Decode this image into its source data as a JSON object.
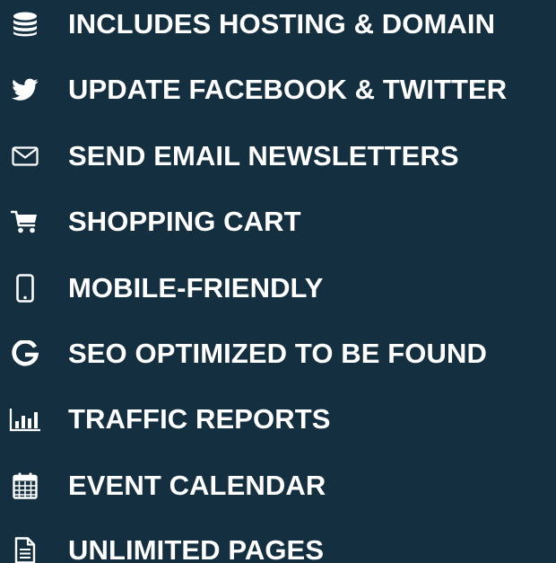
{
  "theme": {
    "background": "#142f40",
    "text": "#ffffff"
  },
  "features": [
    {
      "icon": "database-icon",
      "label": "INCLUDES HOSTING & DOMAIN"
    },
    {
      "icon": "twitter-bird-icon",
      "label": "UPDATE FACEBOOK & TWITTER"
    },
    {
      "icon": "envelope-icon",
      "label": "SEND EMAIL NEWSLETTERS"
    },
    {
      "icon": "shopping-cart-icon",
      "label": "SHOPPING CART"
    },
    {
      "icon": "mobile-phone-icon",
      "label": "MOBILE-FRIENDLY"
    },
    {
      "icon": "google-g-icon",
      "label": "SEO OPTIMIZED TO BE FOUND"
    },
    {
      "icon": "bar-chart-icon",
      "label": "TRAFFIC REPORTS"
    },
    {
      "icon": "calendar-icon",
      "label": "EVENT CALENDAR"
    },
    {
      "icon": "document-icon",
      "label": "UNLIMITED PAGES"
    }
  ]
}
